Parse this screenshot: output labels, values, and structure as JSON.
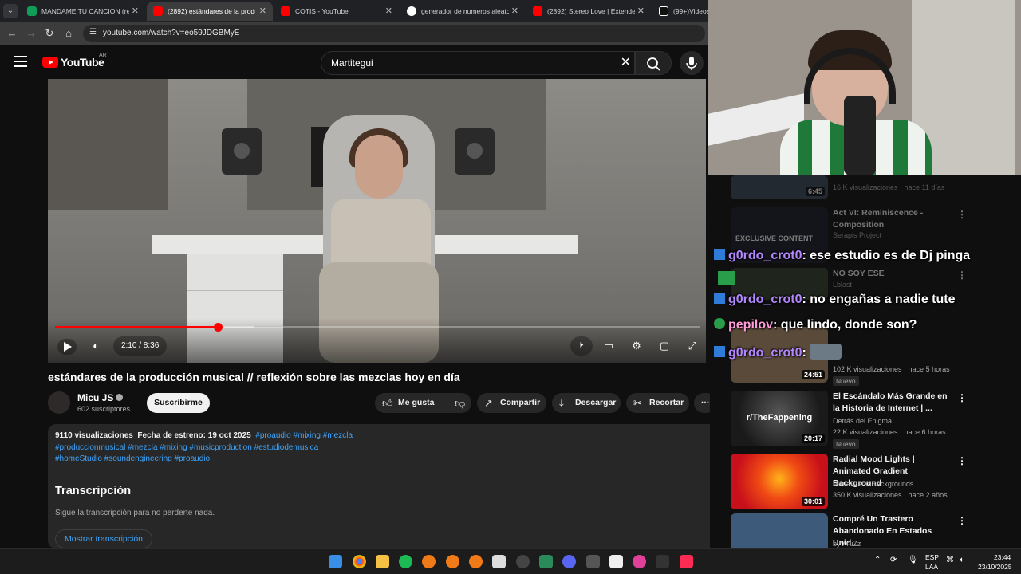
{
  "browser": {
    "tabs": [
      {
        "title": "MANDAME TU CANCION (resp",
        "color": "#0f9d58",
        "active": false
      },
      {
        "title": "(2892) estándares de la produc",
        "color": "#ff0000",
        "active": true
      },
      {
        "title": "COTIS - YouTube",
        "color": "#ff0000",
        "active": false
      },
      {
        "title": "generador de numeros aleatori",
        "color": "#ffffff",
        "active": false
      },
      {
        "title": "(2892) Stereo Love | Extended",
        "color": "#ff0000",
        "active": false
      },
      {
        "title": "(99+)Videos d",
        "color": "#111111",
        "active": false
      }
    ],
    "url": "youtube.com/watch?v=eo59JDGBMyE"
  },
  "youtube": {
    "logo_text": "YouTube",
    "country": "AR",
    "search_value": "Martitegui"
  },
  "player": {
    "current_time": "2:10",
    "duration": "8:36",
    "time_display": "2:10 / 8:36",
    "progress_fraction": 0.252,
    "buffered_fraction": 0.31
  },
  "video": {
    "title": "estándares de la producción musical // reflexión sobre las mezclas hoy en día",
    "channel": "Micu JS",
    "subscribers": "602 suscriptores",
    "subscribe_label": "Suscribirme",
    "actions": {
      "like": "Me gusta",
      "share": "Compartir",
      "download": "Descargar",
      "clip": "Recortar"
    },
    "description": {
      "views": "9110 visualizaciones",
      "date": "Fecha de estreno: 19 oct 2025",
      "tags_line1": "#proaudio #mixing #mezcla",
      "tags_line2": "#produccionmusical #mezcla #mixing #musicproduction #estudiodemusica",
      "tags_line3": "#homeStudio #soundengineering #proaudio",
      "transcript_heading": "Transcripción",
      "transcript_sub": "Sigue la transcripción para no perderte nada.",
      "transcript_button": "Mostrar transcripción"
    }
  },
  "sidebar": {
    "items": [
      {
        "title": "",
        "channel": "",
        "stats": "16 K visualizaciones · hace 11 días",
        "duration": "6:45",
        "badge": "",
        "thumb": "#3a4a5a"
      },
      {
        "title": "Act VI: Reminiscence - Composition",
        "channel": "Serapis Project",
        "stats": "",
        "duration": "",
        "badge": "",
        "thumb": "#1c1c2a",
        "thumb_text": "EXCLUSIVE CONTENT"
      },
      {
        "title": "NO SOY ESE",
        "channel": "Lblast",
        "stats": "",
        "duration": "",
        "badge": "",
        "thumb": "#33402e"
      },
      {
        "title": "",
        "channel": "",
        "stats": "102 K visualizaciones · hace 5 horas",
        "duration": "24:51",
        "badge": "Nuevo",
        "thumb": "#5a4a3a"
      },
      {
        "title": "El Escándalo Más Grande en la Historia de Internet | ...",
        "channel": "Detrás del Enigma",
        "stats": "22 K visualizaciones · hace 6 horas",
        "duration": "20:17",
        "badge": "Nuevo",
        "thumb": "#2a2a2a",
        "thumb_text": "r/TheFappening"
      },
      {
        "title": "Radial Mood Lights | Animated Gradient Background",
        "channel": "Visuals and Backgrounds",
        "stats": "350 K visualizaciones · hace 2 años",
        "duration": "30:01",
        "badge": "",
        "thumb": "#e0261a"
      },
      {
        "title": "Compré Un Trastero Abandonado En Estados Unid...",
        "channel": "byViruZz",
        "stats": "",
        "duration": "",
        "badge": "",
        "thumb": "#3d5a7a"
      }
    ]
  },
  "chat": {
    "messages": [
      {
        "user": "g0rdo_crot0",
        "text": ": ese estudio es de Dj pinga"
      },
      {
        "user": "g0rdo_crot0",
        "text": ": no engañas a nadie tute"
      },
      {
        "user": "pepilov",
        "text": ": que lindo, donde son?"
      },
      {
        "user": "g0rdo_crot0",
        "text": ":"
      }
    ]
  },
  "taskbar": {
    "lang": "ESP",
    "layout": "LAA",
    "time": "23:44",
    "date": "23/10/2025"
  }
}
